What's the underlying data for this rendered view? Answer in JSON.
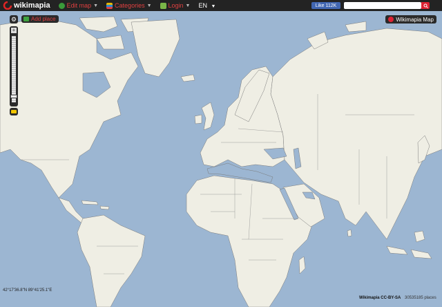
{
  "header": {
    "logo_text": "wikimapia",
    "menu": [
      {
        "label": "Edit map",
        "icon": "globe-icon"
      },
      {
        "label": "Categories",
        "icon": "categories-icon"
      },
      {
        "label": "Login",
        "icon": "login-icon"
      }
    ],
    "language": "EN",
    "like_label": "Like 112K",
    "search_placeholder": ""
  },
  "controls": {
    "add_place_label": "Add place",
    "map_type_label": "Wikimapia Map"
  },
  "status": {
    "coordinates": "42°17'36.8\"N 89°41'25.1\"E",
    "credits": "Wikimapia CC-BY-SA",
    "places_count": "30535185 places"
  },
  "colors": {
    "ocean": "#9cb6d2",
    "land": "#efeee4",
    "border": "#7a7a7a",
    "accent": "#e04040",
    "topbar": "#232323"
  }
}
